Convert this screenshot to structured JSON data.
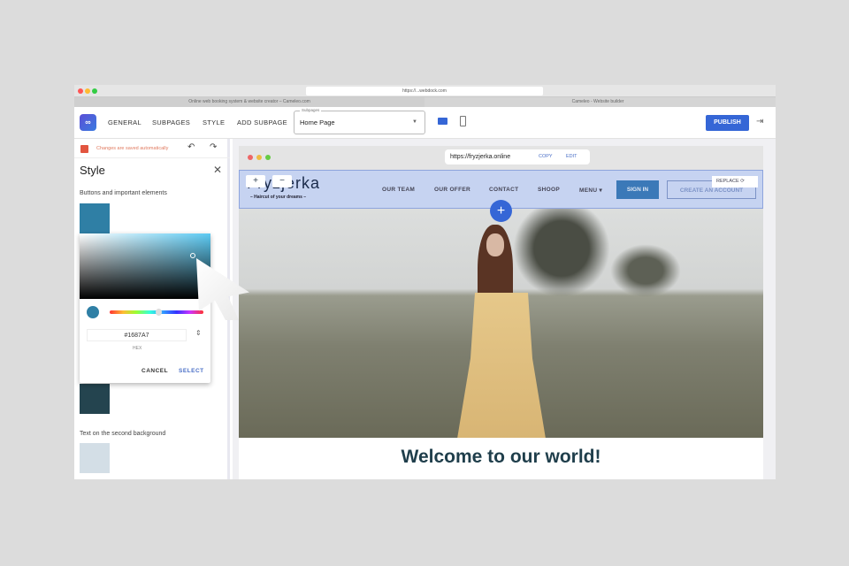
{
  "browser": {
    "url": "https://...webdock.com",
    "tabs": [
      "Online web booking system & website creator – Cameleo.com",
      "Cameleo - Website builder"
    ]
  },
  "topbar": {
    "nav": [
      "GENERAL",
      "SUBPAGES",
      "STYLE",
      "ADD SUBPAGE"
    ],
    "subpages_label": "Subpages",
    "subpages_value": "Home Page",
    "publish": "PUBLISH"
  },
  "sidebar": {
    "save_status": "Changes are saved automatically",
    "title": "Style",
    "section1": "Buttons and important elements",
    "section2": "Text on the second background",
    "swatches": [
      "#2f7fa5",
      "#24444f",
      "#d3dee6"
    ]
  },
  "picker": {
    "hex": "#1687A7",
    "hex_label": "HEX",
    "cancel": "CANCEL",
    "select": "SELECT",
    "accent": "#1687A7"
  },
  "site": {
    "url": "https://fryzjerka.online",
    "copy": "COPY",
    "edit": "EDIT",
    "logo": "Fryzjerka",
    "tagline": "– Haircut of your dreams –",
    "nav": [
      "OUR TEAM",
      "OUR OFFER",
      "CONTACT",
      "SHOOP",
      "MENU ▾"
    ],
    "sign_in": "SIGN IN",
    "create_account": "CREATE AN ACCOUNT",
    "replace": "REPLACE",
    "welcome": "Welcome to our world!"
  }
}
